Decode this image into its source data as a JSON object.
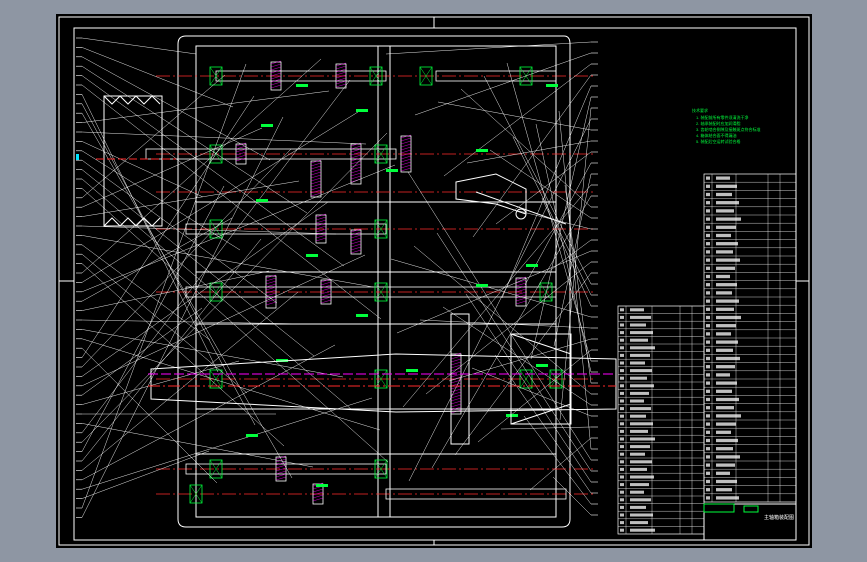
{
  "colors": {
    "background": "#8e96a3",
    "sheet": "#000000",
    "line": "#ffffff",
    "centerline": "#ff2a2a",
    "dimension": "#00ff3c",
    "shaft": "#ffff00",
    "hatch": "#ff00ff",
    "accent": "#00e5ff"
  },
  "drawing": {
    "tech_note_title": "技术要求",
    "tech_notes": [
      "1. 装配前所有零件须清洗干净",
      "2. 轴承装配时应加润滑脂",
      "3. 齿轮啮合侧隙及接触斑点符合标准",
      "4. 箱体结合面不得漏油",
      "5. 装配后空运转试验合格"
    ],
    "title_block_name": "主轴箱装配图"
  }
}
